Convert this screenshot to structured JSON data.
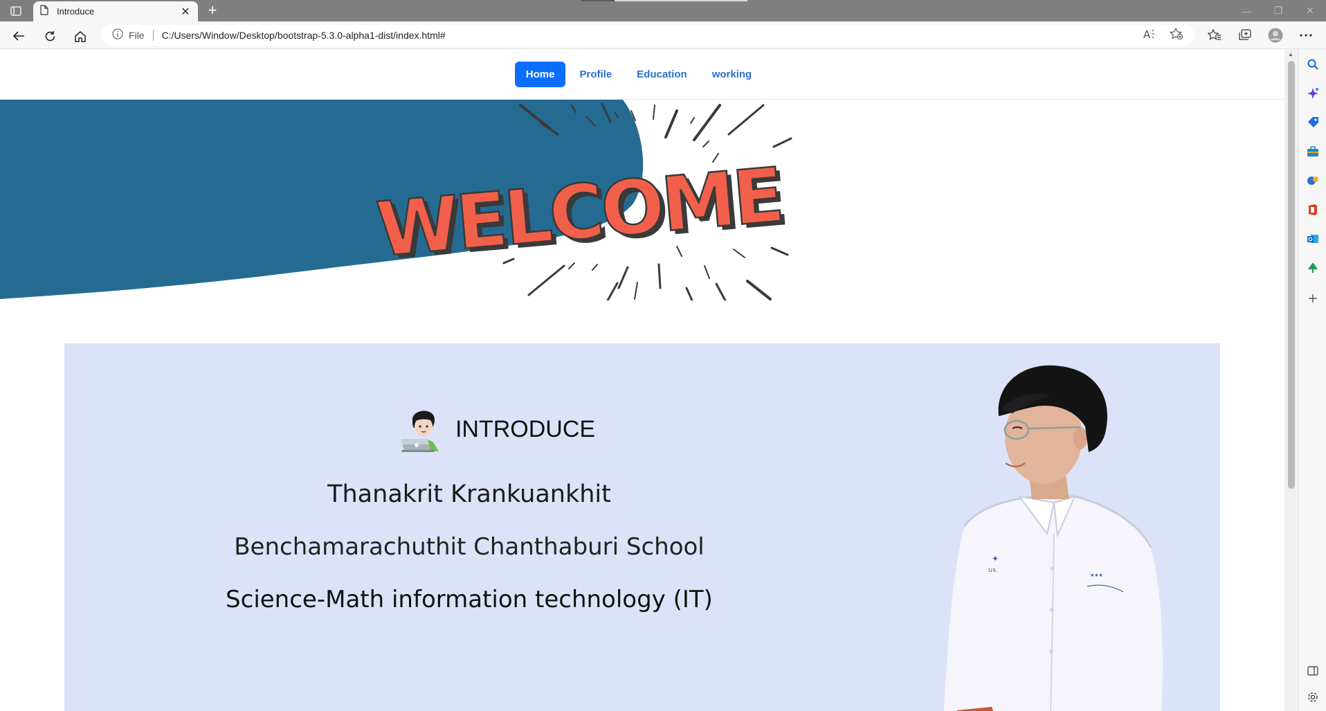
{
  "browser": {
    "tab_title": "Introduce",
    "url_scheme_label": "File",
    "url": "C:/Users/Window/Desktop/bootstrap-5.3.0-alpha1-dist/index.html#"
  },
  "nav": {
    "items": [
      {
        "label": "Home",
        "active": true
      },
      {
        "label": "Profile",
        "active": false
      },
      {
        "label": "Education",
        "active": false
      },
      {
        "label": "working",
        "active": false
      }
    ]
  },
  "hero": {
    "banner_text": "WELCOME",
    "colors": {
      "wave": "#256b91",
      "letters": "#f2604b",
      "outline": "#3a3a3a"
    }
  },
  "intro": {
    "heading": "INTRODUCE",
    "name": "Thanakrit Krankuankhit",
    "school": "Benchamarachuthit Chanthaburi School",
    "program": "Science-Math information technology (IT)",
    "background": "#dce3f8"
  },
  "icons": {
    "tab": "page-icon",
    "heading": "technologist-emoji-icon",
    "sidebar": [
      "search-icon",
      "copilot-icon",
      "shopping-icon",
      "tools-icon",
      "games-icon",
      "office-icon",
      "outlook-icon",
      "drop-icon",
      "add-icon"
    ]
  }
}
